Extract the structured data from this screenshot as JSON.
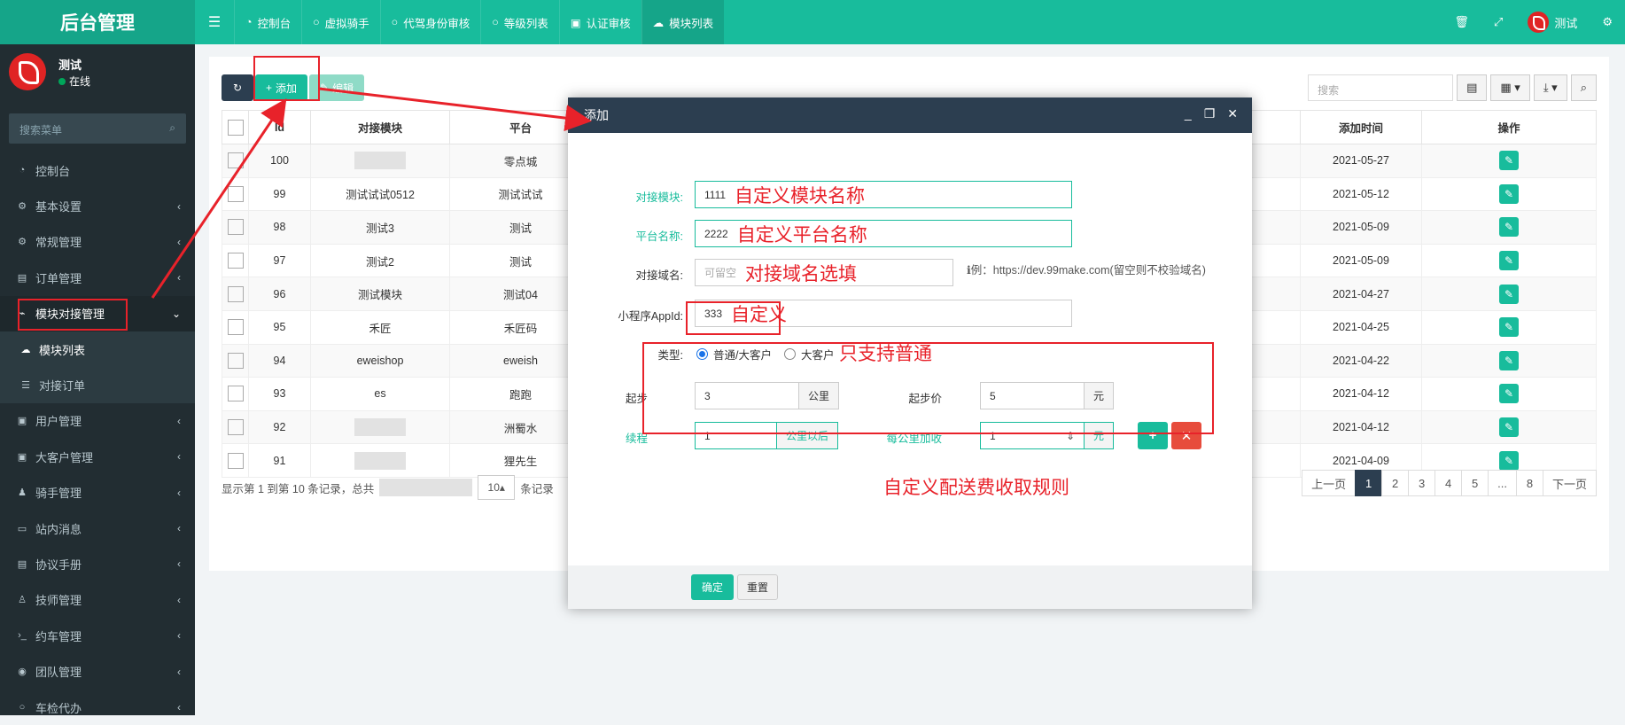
{
  "brand": "后台管理",
  "nav_tabs": [
    "控制台",
    "虚拟骑手",
    "代驾身份审核",
    "等级列表",
    "认证审核",
    "模块列表"
  ],
  "top_user": "测试",
  "user": {
    "name": "测试",
    "status": "在线"
  },
  "menu_search_placeholder": "搜索菜单",
  "menu": [
    {
      "label": "控制台",
      "icon": "dashboard-icon"
    },
    {
      "label": "基本设置",
      "icon": "gear-icon"
    },
    {
      "label": "常规管理",
      "icon": "gears-icon"
    },
    {
      "label": "订单管理",
      "icon": "book-icon"
    },
    {
      "label": "模块对接管理",
      "icon": "plug-icon"
    },
    {
      "label": "模块列表",
      "icon": "cloud-icon"
    },
    {
      "label": "对接订单",
      "icon": "list-icon"
    },
    {
      "label": "用户管理",
      "icon": "user-icon"
    },
    {
      "label": "大客户管理",
      "icon": "id-card-icon"
    },
    {
      "label": "骑手管理",
      "icon": "rider-icon"
    },
    {
      "label": "站内消息",
      "icon": "message-icon"
    },
    {
      "label": "协议手册",
      "icon": "manual-icon"
    },
    {
      "label": "技师管理",
      "icon": "walk-icon"
    },
    {
      "label": "约车管理",
      "icon": "terminal-icon"
    },
    {
      "label": "团队管理",
      "icon": "eye-icon"
    },
    {
      "label": "车检代办",
      "icon": "circle-icon"
    }
  ],
  "toolbar": {
    "add": "添加",
    "edit": "编辑",
    "search_placeholder": "搜索"
  },
  "table": {
    "headers": [
      "Id",
      "对接模块",
      "平台",
      "添加时间",
      "操作"
    ],
    "rows": [
      {
        "id": "100",
        "module": "",
        "platform": "零点城",
        "date": "2021-05-27"
      },
      {
        "id": "99",
        "module": "测试试试0512",
        "platform": "测试试试",
        "date": "2021-05-12"
      },
      {
        "id": "98",
        "module": "测试3",
        "platform": "测试",
        "date": "2021-05-09"
      },
      {
        "id": "97",
        "module": "测试2",
        "platform": "测试",
        "date": "2021-05-09"
      },
      {
        "id": "96",
        "module": "测试模块",
        "platform": "测试04",
        "date": "2021-04-27"
      },
      {
        "id": "95",
        "module": "禾匠",
        "platform": "禾匠码",
        "date": "2021-04-25"
      },
      {
        "id": "94",
        "module": "eweishop",
        "platform": "eweish",
        "date": "2021-04-22"
      },
      {
        "id": "93",
        "module": "es",
        "platform": "跑跑",
        "date": "2021-04-12"
      },
      {
        "id": "92",
        "module": "",
        "platform": "洲蜀水",
        "date": "2021-04-12"
      },
      {
        "id": "91",
        "module": "",
        "platform": "狸先生",
        "date": "2021-04-09"
      }
    ]
  },
  "footer": {
    "info": "显示第 1 到第 10 条记录，总共",
    "page_size": "10",
    "suffix": "条记录"
  },
  "pager": [
    "上一页",
    "1",
    "2",
    "3",
    "4",
    "5",
    "...",
    "8",
    "下一页"
  ],
  "modal": {
    "title": "添加",
    "fields": {
      "module_label": "对接模块:",
      "module_value": "1111",
      "platform_label": "平台名称:",
      "platform_value": "2222",
      "domain_label": "对接域名:",
      "domain_placeholder": "可留空",
      "domain_hint": "例：https://dev.99make.com(留空则不校验域名)",
      "appid_label": "小程序AppId:",
      "appid_value": "333",
      "type_label": "类型:",
      "type_opt1": "普通/大客户",
      "type_opt2": "大客户",
      "start_label": "起步",
      "start_value": "3",
      "start_unit": "公里",
      "startprice_label": "起步价",
      "startprice_value": "5",
      "startprice_unit": "元",
      "cont_label": "续程",
      "cont_value": "1",
      "cont_unit": "公里以后",
      "perkm_label": "每公里加收",
      "perkm_value": "1",
      "perkm_unit": "元"
    },
    "ok": "确定",
    "reset": "重置"
  },
  "annotations": {
    "module": "自定义模块名称",
    "platform": "自定义平台名称",
    "domain": "对接域名选填",
    "appid": "自定义",
    "type": "只支持普通",
    "rule": "自定义配送费收取规则"
  },
  "colors": {
    "primary": "#18bc9c",
    "dark": "#2c3e50",
    "sidebar": "#222d32",
    "annotation": "#e8222a"
  }
}
